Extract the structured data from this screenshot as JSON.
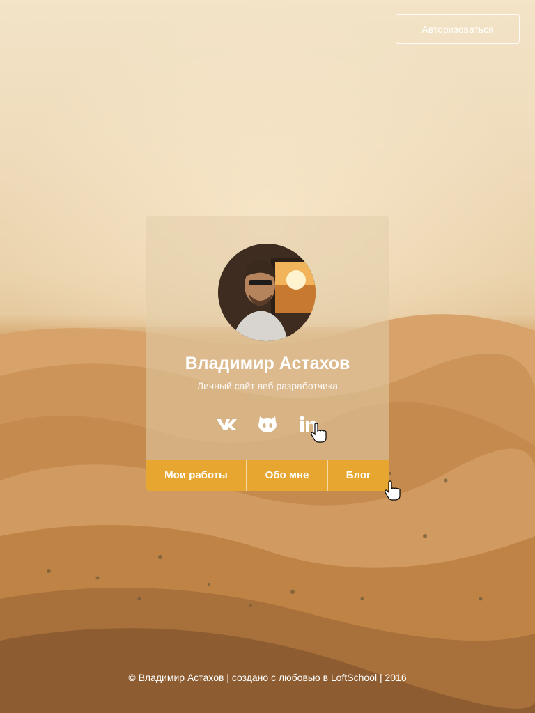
{
  "header": {
    "auth_label": "Авторизоваться"
  },
  "profile": {
    "name": "Владимир Астахов",
    "subtitle": "Личный сайт веб разработчика",
    "avatar_icon": "avatar-photo"
  },
  "socials": [
    {
      "icon": "vk-icon"
    },
    {
      "icon": "github-icon"
    },
    {
      "icon": "linkedin-icon"
    }
  ],
  "nav": {
    "items": [
      {
        "label": "Мои работы"
      },
      {
        "label": "Обо мне"
      },
      {
        "label": "Блог"
      }
    ]
  },
  "footer": {
    "text": "© Владимир Астахов | создано с любовью в LoftSchool | 2016"
  },
  "colors": {
    "accent": "#e6a62f",
    "text": "#ffffff"
  }
}
